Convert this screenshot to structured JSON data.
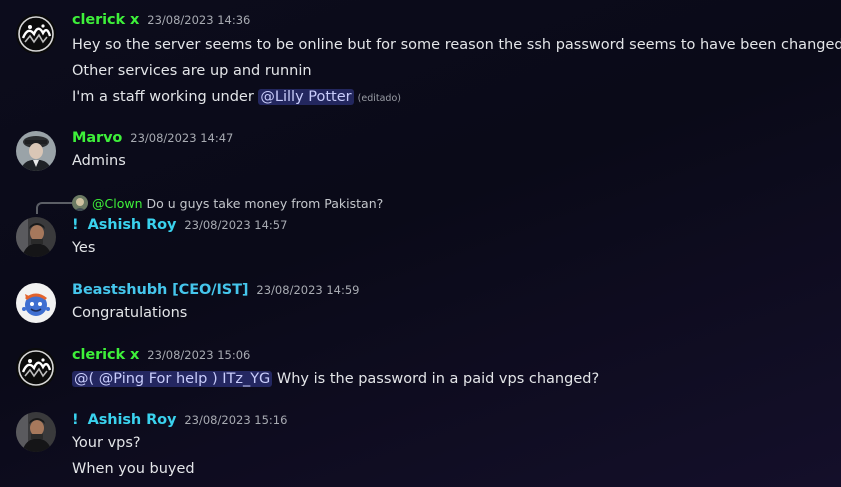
{
  "messages": [
    {
      "user": "clerick x",
      "time": "23/08/2023 14:36",
      "lines": [
        "Hey so the server seems to be online but for some reason the ssh password seems to have been changed",
        "Other services are up and runnin",
        "I'm a staff working under"
      ],
      "mention": "@Lilly Potter",
      "edited": "(editado)"
    },
    {
      "user": "Marvo",
      "time": "23/08/2023 14:47",
      "lines": [
        "Admins"
      ]
    },
    {
      "reply_to": "@Clown",
      "reply_text": "Do u guys take money from Pakistan?",
      "prefix": "!",
      "user": "Ashish Roy",
      "time": "23/08/2023 14:57",
      "lines": [
        "Yes"
      ]
    },
    {
      "user": "Beastshubh [CEO/IST]",
      "time": "23/08/2023 14:59",
      "lines": [
        "Congratulations"
      ]
    },
    {
      "user": "clerick x",
      "time": "23/08/2023 15:06",
      "mention": "@( @Ping For help ) ITz_YG",
      "lines": [
        "Why is the password in a paid vps changed?"
      ]
    },
    {
      "prefix": "!",
      "user": "Ashish Roy",
      "time": "23/08/2023 15:16",
      "lines": [
        "Your vps?",
        "When you buyed"
      ]
    }
  ],
  "colors": {
    "green_name": "#3ef03a",
    "cyan_name": "#3ad2ee",
    "mention_bg": "#3a3f8f"
  }
}
